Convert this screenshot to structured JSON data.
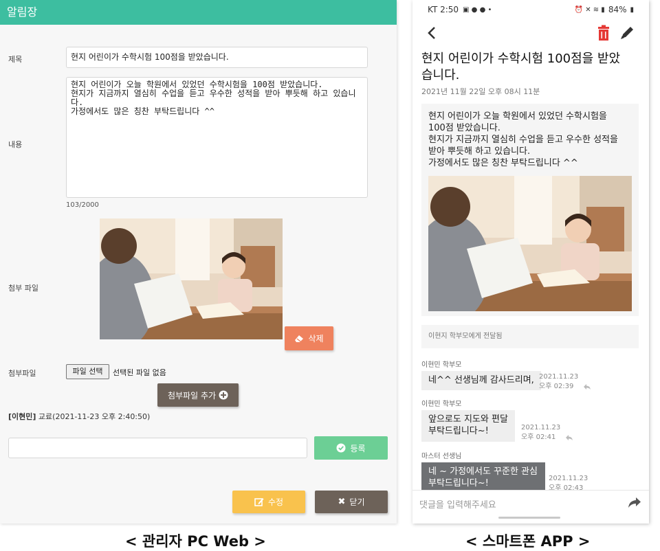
{
  "pc": {
    "header_title": "알림장",
    "labels": {
      "title": "제목",
      "content": "내용",
      "attachment": "첨부 파일",
      "attachment_file": "첨부파일"
    },
    "title_value": "현지 어린이가 수학시험 100점을 받았습니다.",
    "content_value": "현지 어린이가 오늘 학원에서 있었던 수학시험을 100점 받았습니다.\n현지가 지금까지 열심히 수업을 듣고 우수한 성적을 받아 뿌듯해 하고 있습니다.\n가정에서도 많은 칭찬 부탁드립니다 ^^",
    "char_count": "103/2000",
    "delete_label": "삭제",
    "file_select_label": "파일 선택",
    "file_status": "선택된 파일 없음",
    "add_file_label": "첨부파일 추가",
    "log_name": "[이현민]",
    "log_text": " 교료(2021-11-23 오후 2:40:50)",
    "register_label": "등록",
    "edit_label": "수정",
    "close_label": "닫기",
    "colors": {
      "header": "#3dbea0",
      "delete": "#ef825e",
      "register": "#6ccf95",
      "edit": "#f9c24d",
      "dark": "#6d6259"
    }
  },
  "phone": {
    "status_left": "KT 2:50",
    "status_battery": "84%",
    "title": "현지 어린이가 수학시험 100점을 받았습니다.",
    "date": "2021년 11월 22일 오후 08시 11분",
    "body": "현지 어린이가 오늘 학원에서 있었던 수학시험을\n100점 받았습니다.\n현지가 지금까지 열심히 수업을 듣고 우수한 성적을\n받아 뿌듯해 하고 있습니다.\n가정에서도 많은 칭찬 부탁드립니다 ^^",
    "delivered": "이현지 학부모에게 전달됨",
    "comments": [
      {
        "name": "이현민 학부모",
        "text": "네^^ 선생님께 감사드리며,",
        "date": "2021.11.23",
        "time": "오후 02:39"
      },
      {
        "name": "이현민 학부모",
        "text": "앞으로도 지도와 편달\n부탁드립니다~!",
        "date": "2021.11.23",
        "time": "오후 02:41"
      },
      {
        "name": "마스터 선생님",
        "text": "네 ~ 가정에서도 꾸준한 관심\n부탁드립니다~!",
        "date": "2021.11.23",
        "time": "오후 02:43"
      }
    ],
    "input_placeholder": "댓글을 입력해주세요",
    "colors": {
      "trash": "#e53935"
    }
  },
  "captions": {
    "left": "< 관리자 PC Web >",
    "right": "< 스마트폰 APP >"
  }
}
